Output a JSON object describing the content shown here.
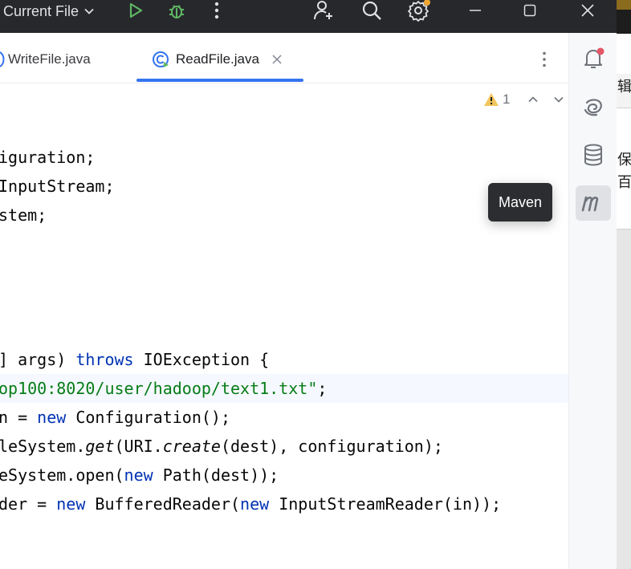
{
  "titlebar": {
    "run_config": "Current File",
    "icons": [
      "chevron-down-icon",
      "run-icon",
      "debug-icon",
      "more-vertical-icon",
      "add-user-icon",
      "search-icon",
      "settings-icon",
      "minimize-icon",
      "maximize-icon",
      "close-icon"
    ],
    "accent_run": "#5fb865",
    "notification_dot": "#f0a732"
  },
  "tabs": [
    {
      "label": "WriteFile.java",
      "active": false
    },
    {
      "label": "ReadFile.java",
      "active": true
    }
  ],
  "accent": "#3574f0",
  "inspections": {
    "warning_count": "1"
  },
  "code_lines": [
    {
      "parts": [
        {
          "t": "iguration;",
          "c": ""
        }
      ]
    },
    {
      "parts": [
        {
          "t": "InputStream;",
          "c": ""
        }
      ]
    },
    {
      "parts": [
        {
          "t": "stem;",
          "c": ""
        }
      ]
    },
    {
      "parts": []
    },
    {
      "parts": []
    },
    {
      "parts": []
    },
    {
      "parts": []
    },
    {
      "parts": [
        {
          "t": "] args) ",
          "c": ""
        },
        {
          "t": "throws",
          "c": "kw"
        },
        {
          "t": " IOException {",
          "c": ""
        }
      ]
    },
    {
      "hl": true,
      "parts": [
        {
          "t": "op100:8020/user/hadoop/text1.txt\"",
          "c": "str"
        },
        {
          "t": ";",
          "c": ""
        }
      ]
    },
    {
      "parts": [
        {
          "t": "n = ",
          "c": ""
        },
        {
          "t": "new",
          "c": "kw"
        },
        {
          "t": " Configuration();",
          "c": ""
        }
      ]
    },
    {
      "parts": [
        {
          "t": "leSystem.",
          "c": ""
        },
        {
          "t": "get",
          "c": "it"
        },
        {
          "t": "(URI.",
          "c": ""
        },
        {
          "t": "create",
          "c": "it"
        },
        {
          "t": "(dest), configuration);",
          "c": ""
        }
      ]
    },
    {
      "parts": [
        {
          "t": "eSystem.open(",
          "c": ""
        },
        {
          "t": "new",
          "c": "kw"
        },
        {
          "t": " Path(dest));",
          "c": ""
        }
      ]
    },
    {
      "parts": [
        {
          "t": "der = ",
          "c": ""
        },
        {
          "t": "new",
          "c": "kw"
        },
        {
          "t": " BufferedReader(",
          "c": ""
        },
        {
          "t": "new",
          "c": "kw"
        },
        {
          "t": " InputStreamReader(in));",
          "c": ""
        }
      ]
    }
  ],
  "right_toolbar": {
    "items": [
      "notifications-icon",
      "ai-assistant-icon",
      "database-icon",
      "maven-icon"
    ],
    "tooltip": "Maven"
  },
  "background_window": {
    "chars": [
      "辑",
      "保",
      "百"
    ]
  }
}
